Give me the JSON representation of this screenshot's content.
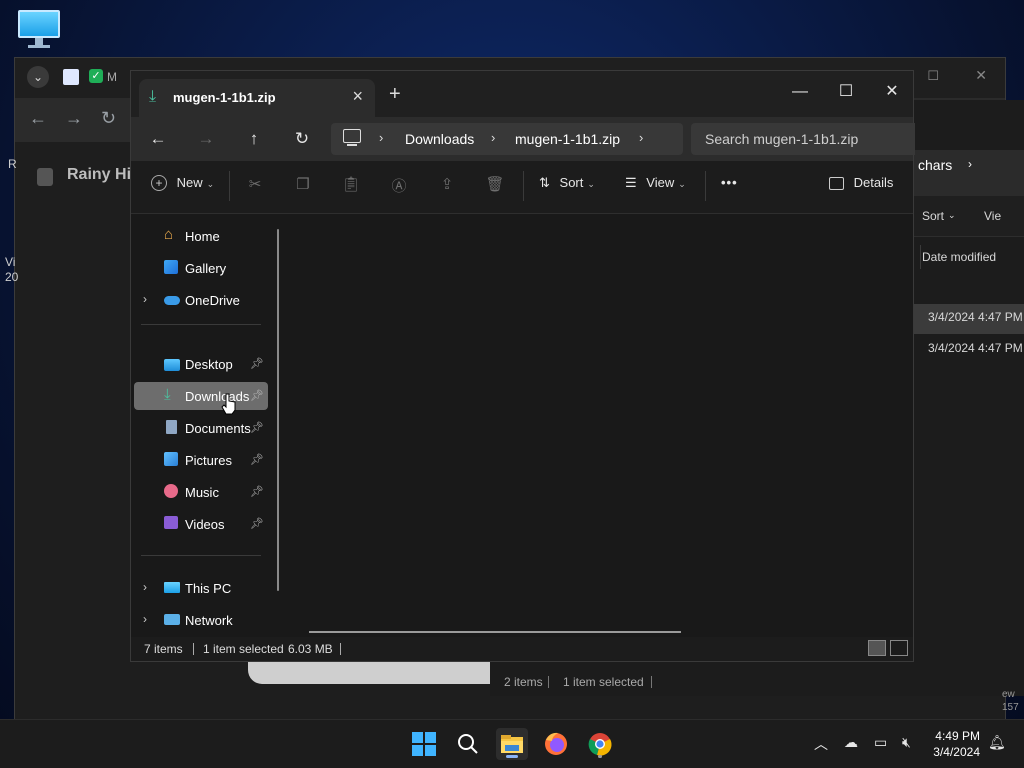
{
  "window": {
    "tab_title": "mugen-1-1b1.zip",
    "new_tab": "+",
    "minimize": "—",
    "maximize": "☐",
    "close": "✕"
  },
  "address": {
    "segments": [
      "Downloads",
      "mugen-1-1b1.zip"
    ],
    "search_placeholder": "Search mugen-1-1b1.zip"
  },
  "command_bar": {
    "new_label": "New",
    "sort_label": "Sort",
    "view_label": "View",
    "more_label": "•••",
    "details_label": "Details"
  },
  "nav_pane": {
    "items": [
      {
        "label": "Home",
        "icon": "home-icon"
      },
      {
        "label": "Gallery",
        "icon": "gallery-icon"
      },
      {
        "label": "OneDrive",
        "icon": "cloud-icon"
      },
      {
        "label": "Desktop",
        "icon": "desktop-folder-icon",
        "pinned": true
      },
      {
        "label": "Downloads",
        "icon": "download-icon",
        "pinned": true,
        "selected": true
      },
      {
        "label": "Documents",
        "icon": "documents-icon",
        "pinned": true
      },
      {
        "label": "Pictures",
        "icon": "pictures-icon",
        "pinned": true
      },
      {
        "label": "Music",
        "icon": "music-icon",
        "pinned": true
      },
      {
        "label": "Videos",
        "icon": "videos-icon",
        "pinned": true
      },
      {
        "label": "This PC",
        "icon": "pc-icon"
      },
      {
        "label": "Network",
        "icon": "network-icon"
      }
    ]
  },
  "status": {
    "items_count": "7 items",
    "selected": "1 item selected",
    "size": "6.03 MB"
  },
  "background_browser": {
    "page_title": "Rainy Hig",
    "tab_text": "M"
  },
  "background_explorer": {
    "crumb": "chars",
    "sort_label": "Sort",
    "view_label": "Vie",
    "column_date": "Date modified",
    "rows": [
      "3/4/2024 4:47 PM",
      "3/4/2024 4:47 PM"
    ],
    "status_items": "2 items",
    "status_selected": "1 item selected"
  },
  "taskbar": {
    "time": "4:49 PM",
    "date": "3/4/2024"
  },
  "colors": {
    "accent": "#4cc2a0",
    "selection": "#6d6d6d",
    "window_bg": "#191919"
  }
}
